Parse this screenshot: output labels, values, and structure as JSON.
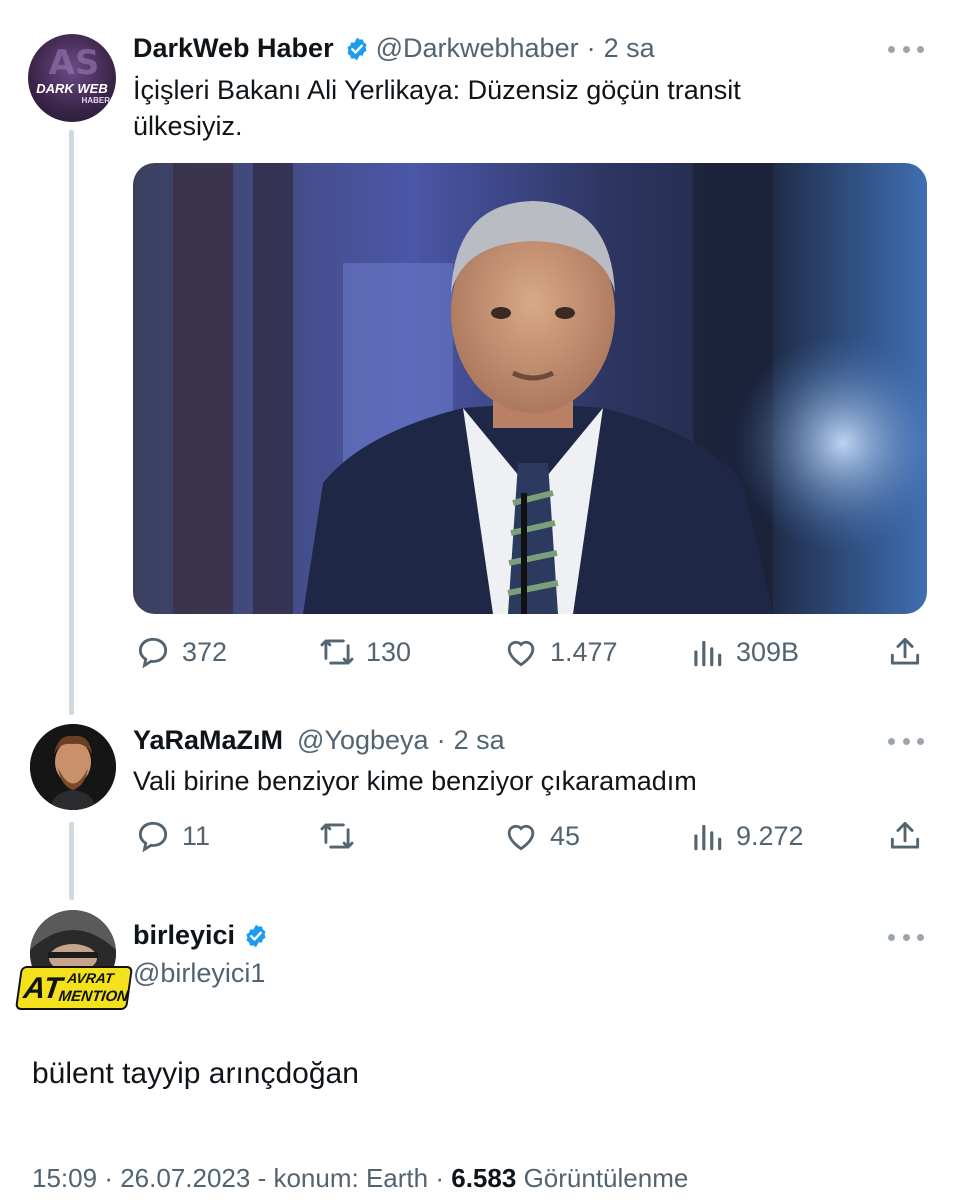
{
  "tweet1": {
    "name": "DarkWeb Haber",
    "handle": "@Darkwebhaber",
    "sep": "·",
    "time": "2 sa",
    "text": "İçişleri Bakanı Ali Yerlikaya: Düzensiz göçün transit ülkesiyiz.",
    "avatar_text_1": "DARK WEB",
    "avatar_text_2": "HABER",
    "stats": {
      "replies": "372",
      "retweets": "130",
      "likes": "1.477",
      "views": "309B"
    }
  },
  "tweet2": {
    "name": "YaRaMaZıM",
    "handle": "@Yogbeya",
    "sep": "·",
    "time": "2 sa",
    "text": "Vali birine benziyor kime benziyor çıkaramadım",
    "stats": {
      "replies": "11",
      "likes": "45",
      "views": "9.272"
    }
  },
  "tweet3": {
    "name": "birleyici",
    "handle": "@birleyici1",
    "badge_text_1": "AT",
    "badge_text_2": "AVRAT",
    "badge_text_3": "MENTION",
    "text": "bülent tayyip arınçdoğan",
    "footer": {
      "time": "15:09",
      "sep1": "·",
      "date": "26.07.2023",
      "location": "- konum: Earth",
      "sep2": "·",
      "views_count": "6.583",
      "views_label": "Görüntülenme"
    }
  },
  "colors": {
    "verified": "#1d9bf0",
    "muted": "#536471",
    "thread": "#cfd9de",
    "badge": "#f2e11b"
  },
  "icons": [
    "verified-icon",
    "more-icon",
    "reply-icon",
    "retweet-icon",
    "like-icon",
    "views-icon",
    "share-icon"
  ]
}
